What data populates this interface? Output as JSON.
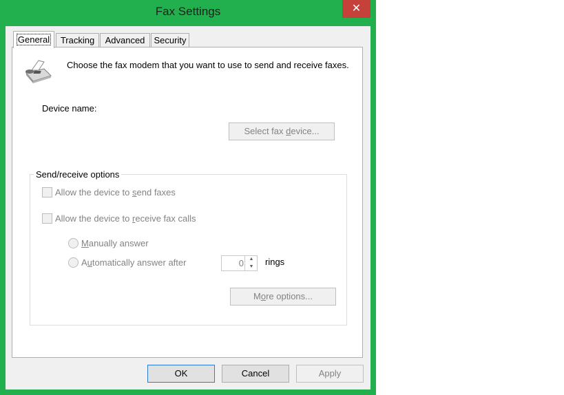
{
  "window": {
    "title": "Fax Settings",
    "close_glyph": "✕"
  },
  "tabs": [
    {
      "label": "General",
      "active": true
    },
    {
      "label": "Tracking"
    },
    {
      "label": "Advanced"
    },
    {
      "label": "Security"
    }
  ],
  "general": {
    "intro_text": "Choose the fax modem that you want to use to send and receive faxes.",
    "device_label": "Device name:",
    "select_device_button": {
      "pre": "Select fax ",
      "accel": "d",
      "post": "evice..."
    },
    "group_title": "Send/receive options",
    "send_checkbox": {
      "pre": "Allow the device to ",
      "accel": "s",
      "post": "end faxes",
      "checked": false
    },
    "receive_checkbox": {
      "pre": "Allow the device to ",
      "accel": "r",
      "post": "eceive fax calls",
      "checked": false
    },
    "manual_radio": {
      "pre": "",
      "accel": "M",
      "post": "anually answer",
      "selected": false
    },
    "auto_radio": {
      "pre": "A",
      "accel": "u",
      "post": "tomatically answer after",
      "selected": false
    },
    "rings_value": "0",
    "rings_label": "rings",
    "more_options_button": {
      "pre": "M",
      "accel": "o",
      "post": "re options..."
    }
  },
  "footer": {
    "ok": "OK",
    "cancel": "Cancel",
    "apply": "Apply"
  },
  "icons": {
    "fax": "fax-machine-icon",
    "spin_up": "▲",
    "spin_down": "▼"
  },
  "colors": {
    "frame": "#22b04f",
    "close": "#c7413b",
    "default_border": "#2b7bd1"
  }
}
